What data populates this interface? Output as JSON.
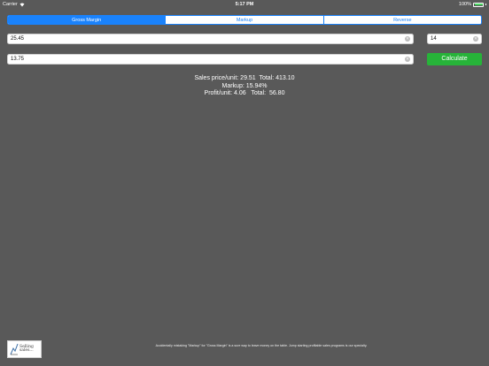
{
  "status_bar": {
    "carrier": "Carrier",
    "time": "5:17 PM",
    "battery_percent": "100%",
    "battery_level": 1.0,
    "battery_color": "#4cd964"
  },
  "segments": {
    "options": [
      "Gross Margin",
      "Markup",
      "Reverse"
    ],
    "selected": "Gross Margin"
  },
  "inputs": {
    "price_value": "25.45",
    "quantity_value": "14",
    "cost_value": "13.75"
  },
  "calculate_label": "Calculate",
  "results": {
    "line1": "Sales price/unit: 29.51  Total: 413.10",
    "line2": "Markup: 15.94%",
    "line3": "Profit/unit: 4.06   Total:  56.80"
  },
  "footer": {
    "logo_text_1": "Selling",
    "logo_text_2": "sales...",
    "message": "Accidentally mistaking \"Markup\" for \"Gross Margin\" is a sure way to leave money on the table. Jump starting profitable sales programs is our specialty."
  },
  "colors": {
    "background": "#595959",
    "accent": "#1a82fb",
    "button": "#27b339"
  },
  "icons": {
    "wifi": "wifi-icon",
    "clear": "clear-circle-icon",
    "logo": "selling-sales-logo"
  }
}
